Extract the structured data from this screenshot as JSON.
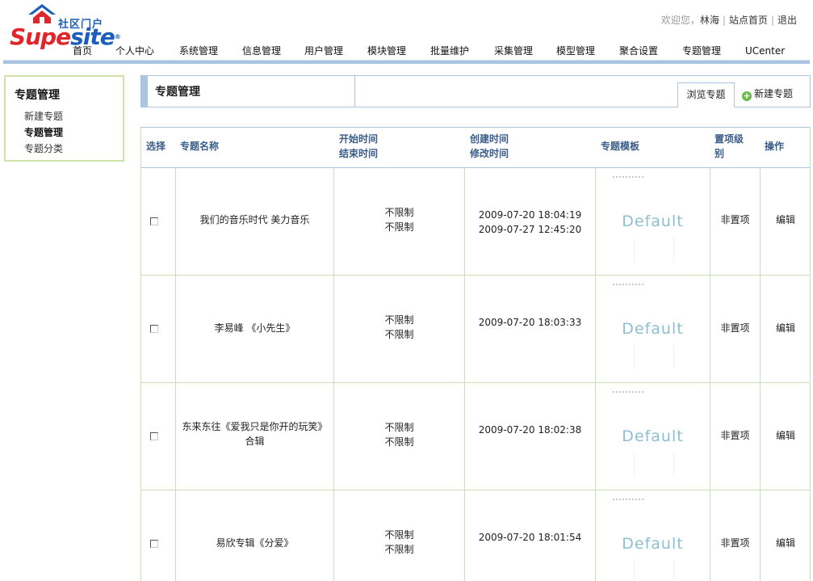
{
  "brand": {
    "cn_label": "社区门户",
    "logo_part1": "Supe",
    "logo_part2": "site",
    "logo_mark": "®"
  },
  "userbar": {
    "welcome": "欢迎您，",
    "username": "林海",
    "home_link": "站点首页",
    "logout_link": "退出"
  },
  "nav": [
    "首页",
    "个人中心",
    "系统管理",
    "信息管理",
    "用户管理",
    "模块管理",
    "批量维护",
    "采集管理",
    "模型管理",
    "聚合设置",
    "专题管理",
    "UCenter"
  ],
  "sidebar": {
    "title": "专题管理",
    "items": [
      {
        "label": "新建专题",
        "active": false
      },
      {
        "label": "专题管理",
        "active": true
      },
      {
        "label": "专题分类",
        "active": false
      }
    ]
  },
  "page": {
    "title": "专题管理",
    "tab_browse": "浏览专题",
    "tab_new": "新建专题"
  },
  "table": {
    "headers": {
      "select": "选择",
      "name": "专题名称",
      "start_time": "开始时间",
      "end_time": "结束时间",
      "created_time": "创建时间",
      "modified_time": "修改时间",
      "template": "专题模板",
      "top_level_1": "置项级",
      "top_level_2": "别",
      "actions": "操作"
    },
    "rows": [
      {
        "name_line1": "我们的音乐时代 美力音乐",
        "name_line2": "",
        "start": "不限制",
        "end": "不限制",
        "created": "2009-07-20 18:04:19",
        "modified": "2009-07-27 12:45:20",
        "template": "Default",
        "top": "非置项",
        "action": "编辑"
      },
      {
        "name_line1": "李易峰 《小先生》",
        "name_line2": "",
        "start": "不限制",
        "end": "不限制",
        "created": "2009-07-20 18:03:33",
        "modified": "",
        "template": "Default",
        "top": "非置项",
        "action": "编辑"
      },
      {
        "name_line1": "东来东往《爱我只是你开的玩笑》",
        "name_line2": "合辑",
        "start": "不限制",
        "end": "不限制",
        "created": "2009-07-20 18:02:38",
        "modified": "",
        "template": "Default",
        "top": "非置项",
        "action": "编辑"
      },
      {
        "name_line1": "易欣专辑《分爱》",
        "name_line2": "",
        "start": "不限制",
        "end": "不限制",
        "created": "2009-07-20 18:01:54",
        "modified": "",
        "template": "Default",
        "top": "非置项",
        "action": "编辑"
      }
    ]
  }
}
